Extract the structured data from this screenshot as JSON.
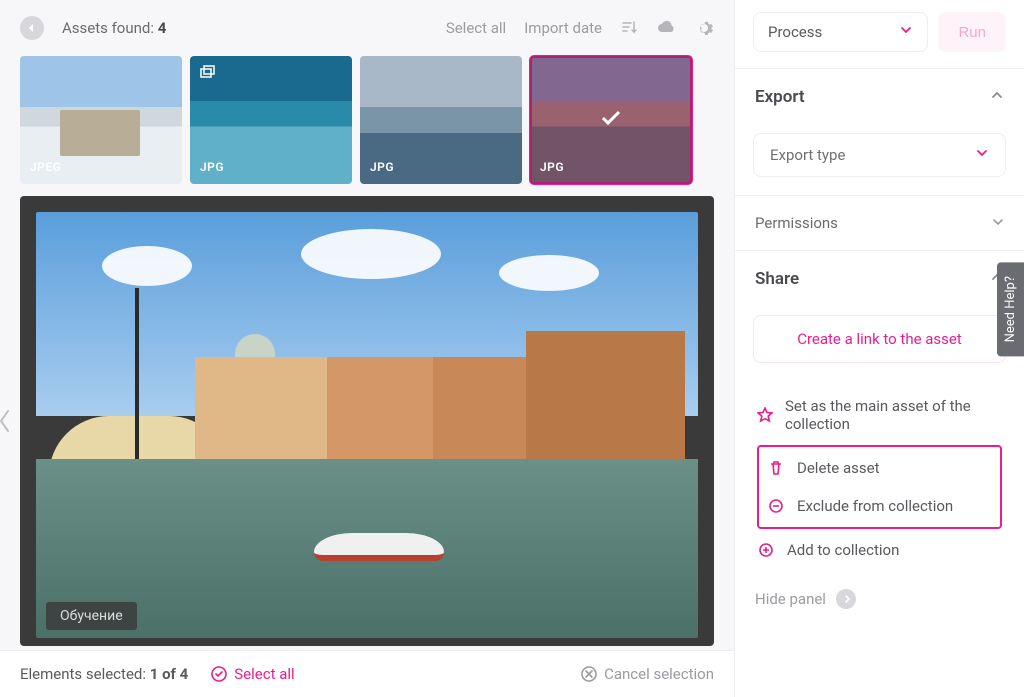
{
  "toolbar": {
    "assets_found_label": "Assets found:",
    "assets_found_count": "4",
    "select_all": "Select all",
    "import_date": "Import date"
  },
  "thumbs": [
    {
      "format": "JPEG",
      "selected": false
    },
    {
      "format": "JPG",
      "selected": false,
      "has_dup_icon": true
    },
    {
      "format": "JPG",
      "selected": false
    },
    {
      "format": "JPG",
      "selected": true
    }
  ],
  "preview": {
    "tag": "Обучение"
  },
  "bottom": {
    "elements_label": "Elements selected:",
    "elements_count": "1 of 4",
    "select_all": "Select all",
    "cancel": "Cancel selection"
  },
  "sidebar": {
    "process": {
      "label": "Process",
      "run": "Run"
    },
    "export": {
      "title": "Export",
      "type_label": "Export type"
    },
    "permissions": {
      "title": "Permissions"
    },
    "share": {
      "title": "Share",
      "create_link": "Create a link to the asset"
    },
    "actions": {
      "set_main": "Set as the main asset of the collection",
      "delete": "Delete asset",
      "exclude": "Exclude from collection",
      "add": "Add to collection"
    },
    "hide_panel": "Hide panel"
  },
  "need_help": "Need Help?"
}
